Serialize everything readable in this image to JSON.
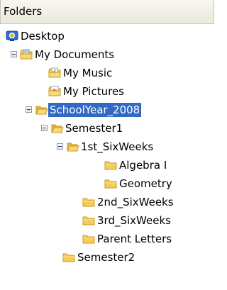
{
  "panel": {
    "title": "Folders"
  },
  "colors": {
    "folder": "#f5cc57",
    "folder_dark": "#c99a22",
    "selection": "#316ac5",
    "desktop_blue": "#2f6fd6"
  },
  "tree": [
    {
      "label": "Desktop",
      "icon": "desktop-icon",
      "expanded": true,
      "selected": false
    },
    {
      "label": "My Documents",
      "icon": "my-documents-icon",
      "expanded": true,
      "selected": false
    },
    {
      "label": "My Music",
      "icon": "my-music-icon",
      "expanded": false,
      "selected": false
    },
    {
      "label": "My Pictures",
      "icon": "my-pictures-icon",
      "expanded": false,
      "selected": false
    },
    {
      "label": "SchoolYear_2008",
      "icon": "folder-open-icon",
      "expanded": true,
      "selected": true
    },
    {
      "label": "Semester1",
      "icon": "folder-open-icon",
      "expanded": true,
      "selected": false
    },
    {
      "label": "1st_SixWeeks",
      "icon": "folder-open-icon",
      "expanded": true,
      "selected": false
    },
    {
      "label": "Algebra I",
      "icon": "folder-icon",
      "expanded": false,
      "selected": false
    },
    {
      "label": "Geometry",
      "icon": "folder-icon",
      "expanded": false,
      "selected": false
    },
    {
      "label": "2nd_SixWeeks",
      "icon": "folder-icon",
      "expanded": false,
      "selected": false
    },
    {
      "label": "3rd_SixWeeks",
      "icon": "folder-icon",
      "expanded": false,
      "selected": false
    },
    {
      "label": "Parent Letters",
      "icon": "folder-icon",
      "expanded": false,
      "selected": false
    },
    {
      "label": "Semester2",
      "icon": "folder-icon",
      "expanded": false,
      "selected": false
    }
  ]
}
